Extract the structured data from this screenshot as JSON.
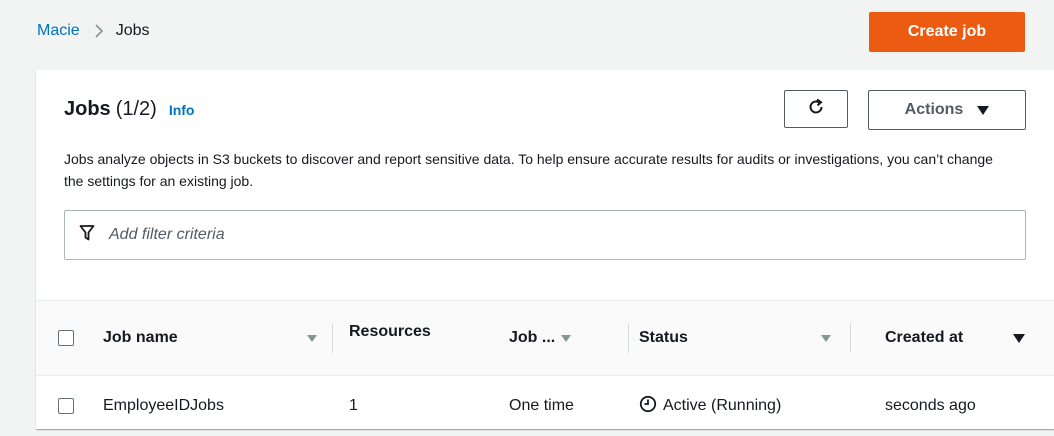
{
  "breadcrumb": {
    "parent": "Macie",
    "current": "Jobs"
  },
  "header": {
    "create_button": "Create job"
  },
  "panel": {
    "title": "Jobs",
    "count": "(1/2)",
    "info_link": "Info",
    "actions_label": "Actions",
    "description": "Jobs analyze objects in S3 buckets to discover and report sensitive data. To help ensure accurate results for audits or investigations, you can’t change the settings for an existing job.",
    "filter_placeholder": "Add filter criteria"
  },
  "table": {
    "columns": [
      "Job name",
      "Resources",
      "Job ...",
      "Status",
      "Created at"
    ],
    "rows": [
      {
        "job_name": "EmployeeIDJobs",
        "resources": "1",
        "job_type": "One time",
        "status": "Active (Running)",
        "created_at": "seconds ago"
      }
    ]
  },
  "colors": {
    "accent": "#ec5b12",
    "link": "#0073bb"
  },
  "icons": {
    "refresh": "refresh-icon",
    "filter": "filter-icon",
    "status": "clock-icon"
  }
}
